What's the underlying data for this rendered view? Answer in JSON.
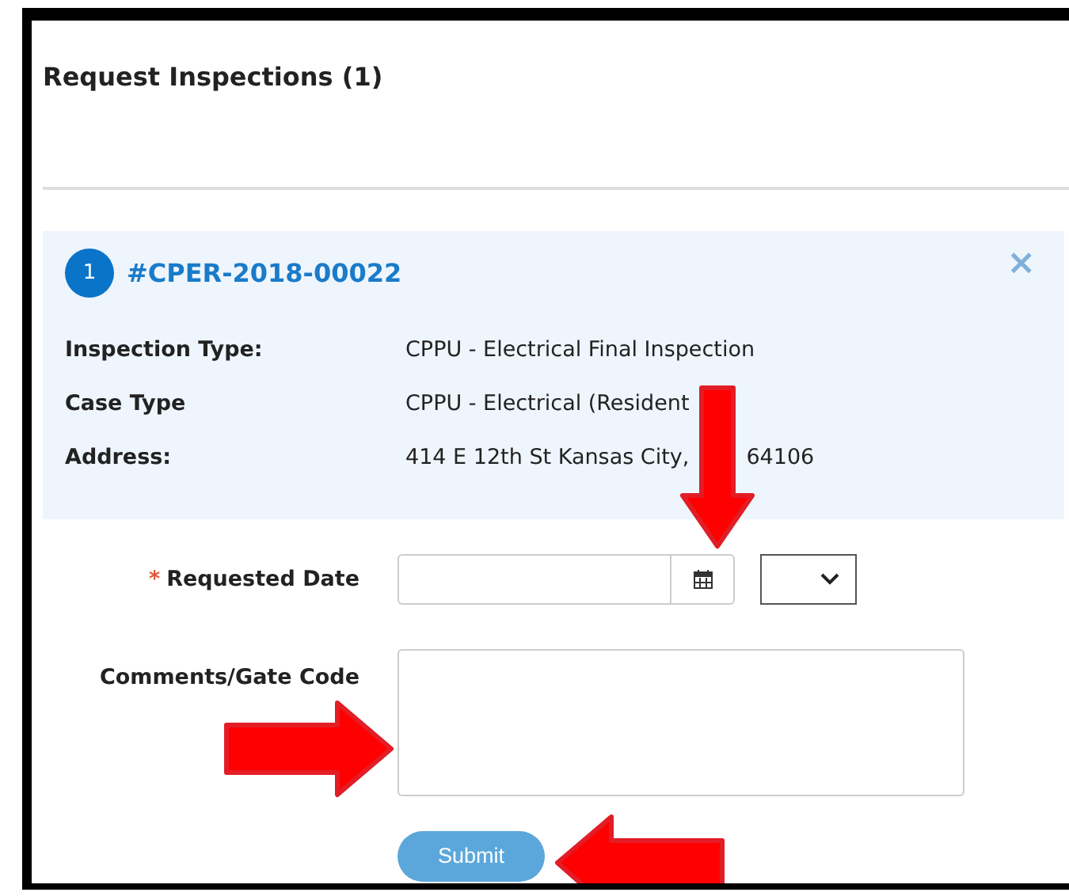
{
  "title": "Request Inspections (1)",
  "case": {
    "number": "1",
    "id": "#CPER-2018-00022",
    "close": "×",
    "fields": [
      {
        "label": "Inspection Type:",
        "value": "CPPU - Electrical Final Inspection"
      },
      {
        "label": "Case Type",
        "value": "CPPU - Electrical (Resident"
      },
      {
        "label": "Address:",
        "value": "414 E 12th St Kansas City,",
        "value_2": "64106"
      }
    ]
  },
  "form": {
    "date": {
      "label": "Requested Date",
      "required": true,
      "marker": "*"
    },
    "comments": {
      "label": "Comments/Gate Code"
    },
    "submit": "Submit"
  },
  "annotations": [
    {
      "kind": "down"
    },
    {
      "kind": "right"
    },
    {
      "kind": "left"
    }
  ]
}
